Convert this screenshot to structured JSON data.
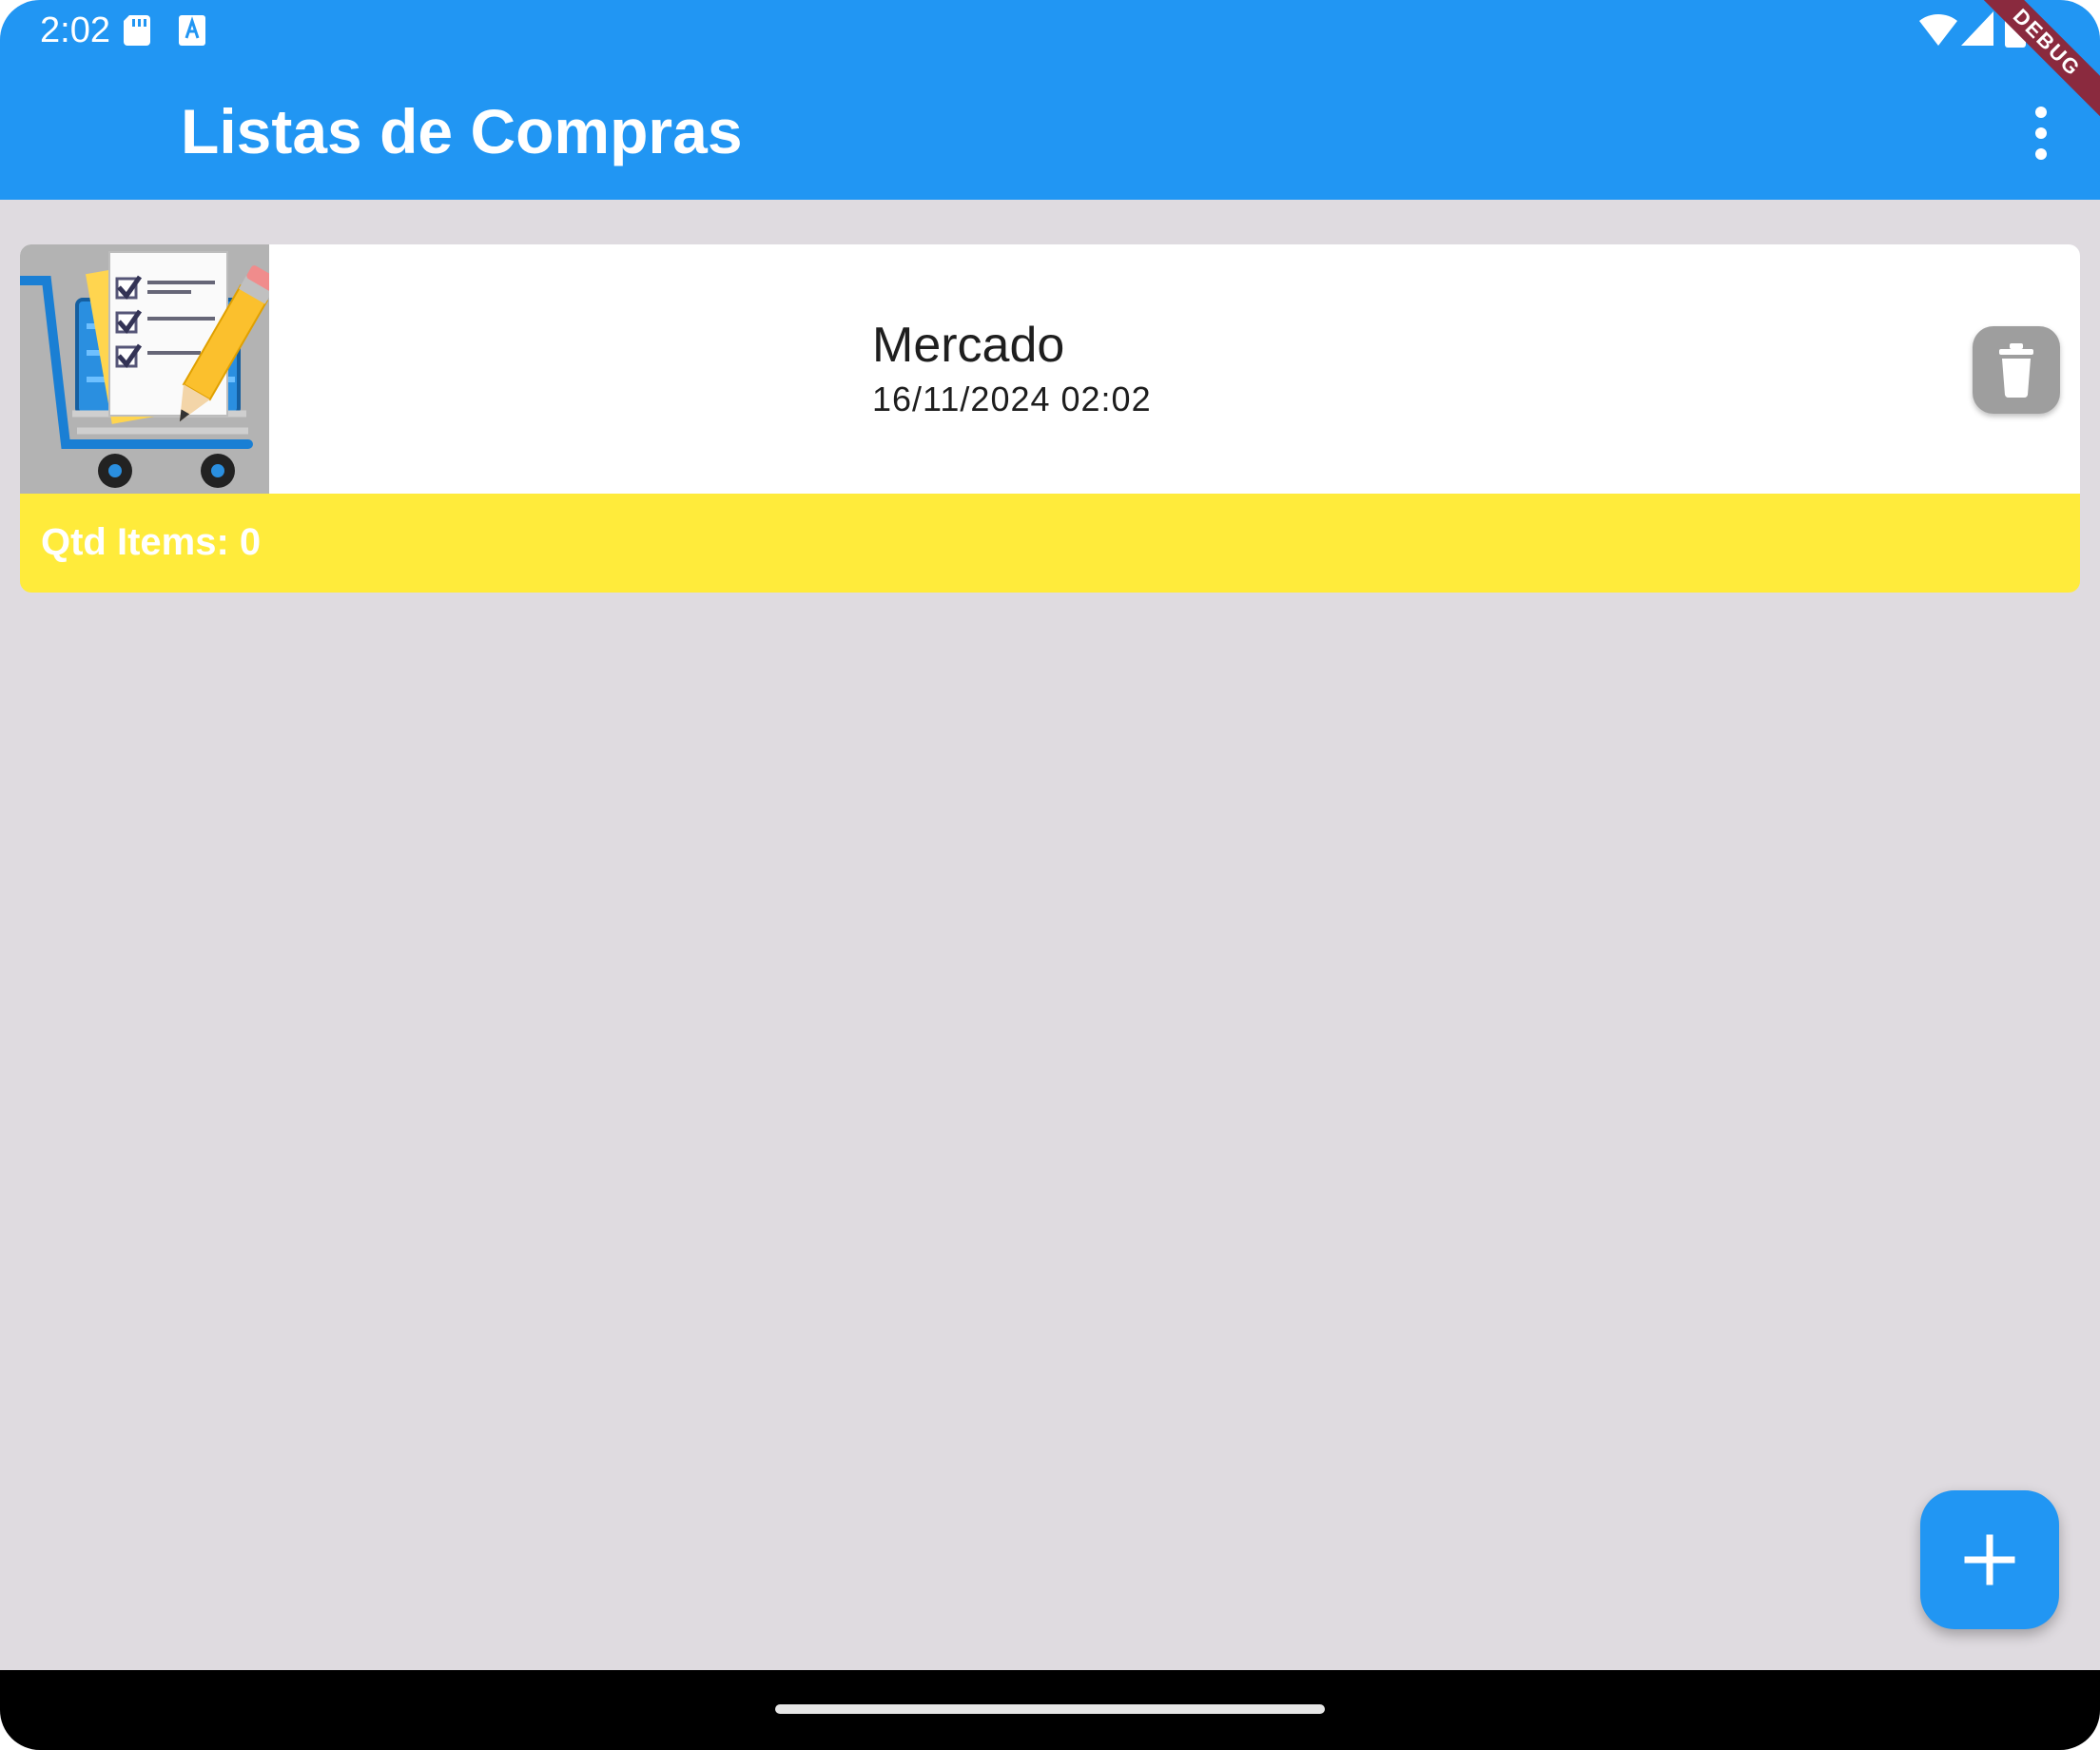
{
  "status_bar": {
    "time": "2:02",
    "icons": [
      "sd-card-icon",
      "keyboard-a-icon",
      "wifi-icon",
      "signal-icon",
      "battery-icon"
    ]
  },
  "debug_banner": "DEBUG",
  "app_bar": {
    "title": "Listas de Compras",
    "menu_icon": "more-vert-icon"
  },
  "lists": [
    {
      "name": "Mercado",
      "date": "16/11/2024 02:02",
      "items_count": "Qtd Items: 0",
      "thumbnail_icon": "shopping-cart-checklist-icon",
      "delete_icon": "trash-icon"
    }
  ],
  "fab": {
    "icon": "plus-icon"
  },
  "colors": {
    "primary": "#2196f3",
    "background": "#dfdbe0",
    "card": "#ffffff",
    "card_footer": "#ffeb3b",
    "delete_button": "#9e9e9e"
  }
}
